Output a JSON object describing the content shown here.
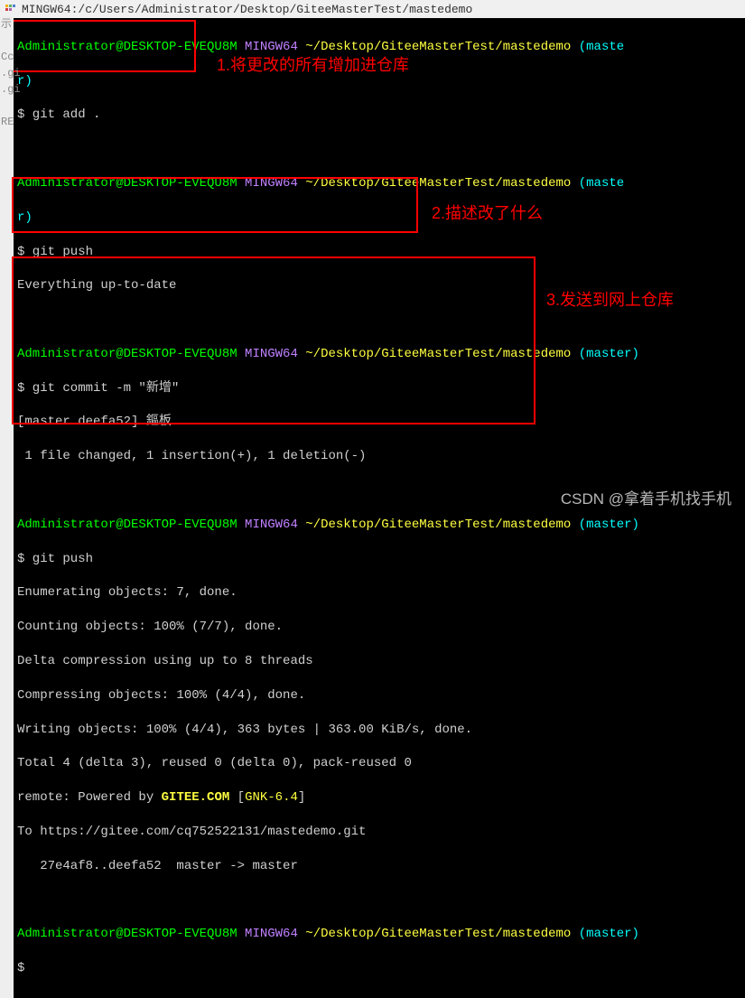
{
  "title_bar": {
    "text": "MINGW64:/c/Users/Administrator/Desktop/GiteeMasterTest/mastedemo"
  },
  "gutter": {
    "l1": "示",
    "l2": "",
    "l3": "Cc",
    "l4": ".gi",
    "l5": ".gi",
    "l6": "",
    "l7": "RE"
  },
  "prompt": {
    "user": "Administrator@DESKTOP-EVEQU8M",
    "shell": "MINGW64",
    "path": "~/Desktop/GiteeMasterTest/mastedemo",
    "branch_wrap": "(maste",
    "branch_r": "r)",
    "branch_full": "(master)"
  },
  "block1": {
    "cmd": "$ git add ."
  },
  "block2": {
    "cmd": "$ git push",
    "out1": "Everything up-to-date"
  },
  "block3": {
    "cmd": "$ git commit -m \"新增\"",
    "out1": "[master deefa52] 鏂板",
    "out2": " 1 file changed, 1 insertion(+), 1 deletion(-)"
  },
  "block4": {
    "cmd": "$ git push",
    "out1": "Enumerating objects: 7, done.",
    "out2": "Counting objects: 100% (7/7), done.",
    "out3": "Delta compression using up to 8 threads",
    "out4": "Compressing objects: 100% (4/4), done.",
    "out5": "Writing objects: 100% (4/4), 363 bytes | 363.00 KiB/s, done.",
    "out6": "Total 4 (delta 3), reused 0 (delta 0), pack-reused 0",
    "out7a": "remote: Powered by ",
    "out7b": "GITEE.COM",
    "out7c": " [",
    "out7d": "GNK-6.4",
    "out7e": "]",
    "out8": "To https://gitee.com/cq752522131/mastedemo.git",
    "out9": "   27e4af8..deefa52  master -> master"
  },
  "block5": {
    "cmd": "$"
  },
  "annotations": {
    "a1": "1.将更改的所有增加进仓库",
    "a2": "2.描述改了什么",
    "a3": "3.发送到网上仓库"
  },
  "watermark": "CSDN @拿着手机找手机"
}
